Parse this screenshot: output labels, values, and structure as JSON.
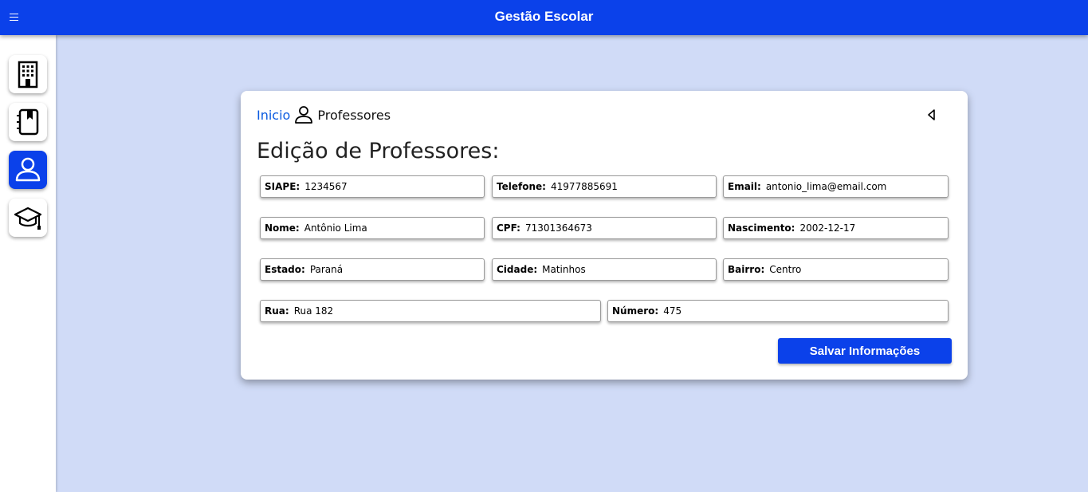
{
  "app": {
    "title": "Gestão Escolar"
  },
  "sidebar": {
    "items": [
      {
        "icon": "building-icon",
        "active": false
      },
      {
        "icon": "address-book-icon",
        "active": false
      },
      {
        "icon": "person-icon",
        "active": true
      },
      {
        "icon": "graduation-cap-icon",
        "active": false
      }
    ]
  },
  "breadcrumb": {
    "home": "Inicio",
    "current": "Professores",
    "current_icon": "person-icon"
  },
  "page": {
    "title": "Edição de Professores:"
  },
  "form": {
    "siape": {
      "label": "SIAPE:",
      "value": "1234567"
    },
    "telefone": {
      "label": "Telefone:",
      "value": "41977885691"
    },
    "email": {
      "label": "Email:",
      "value": "antonio_lima@email.com"
    },
    "nome": {
      "label": "Nome:",
      "value": "Antônio Lima"
    },
    "cpf": {
      "label": "CPF:",
      "value": "71301364673"
    },
    "nascimento": {
      "label": "Nascimento:",
      "value": "2002-12-17"
    },
    "estado": {
      "label": "Estado:",
      "value": "Paraná"
    },
    "cidade": {
      "label": "Cidade:",
      "value": "Matinhos"
    },
    "bairro": {
      "label": "Bairro:",
      "value": "Centro"
    },
    "rua": {
      "label": "Rua:",
      "value": "Rua 182"
    },
    "numero": {
      "label": "Número:",
      "value": "475"
    }
  },
  "actions": {
    "save_label": "Salvar Informações"
  },
  "colors": {
    "primary": "#0b41ea",
    "background": "#d0dbf7",
    "link": "#0b5be0"
  }
}
